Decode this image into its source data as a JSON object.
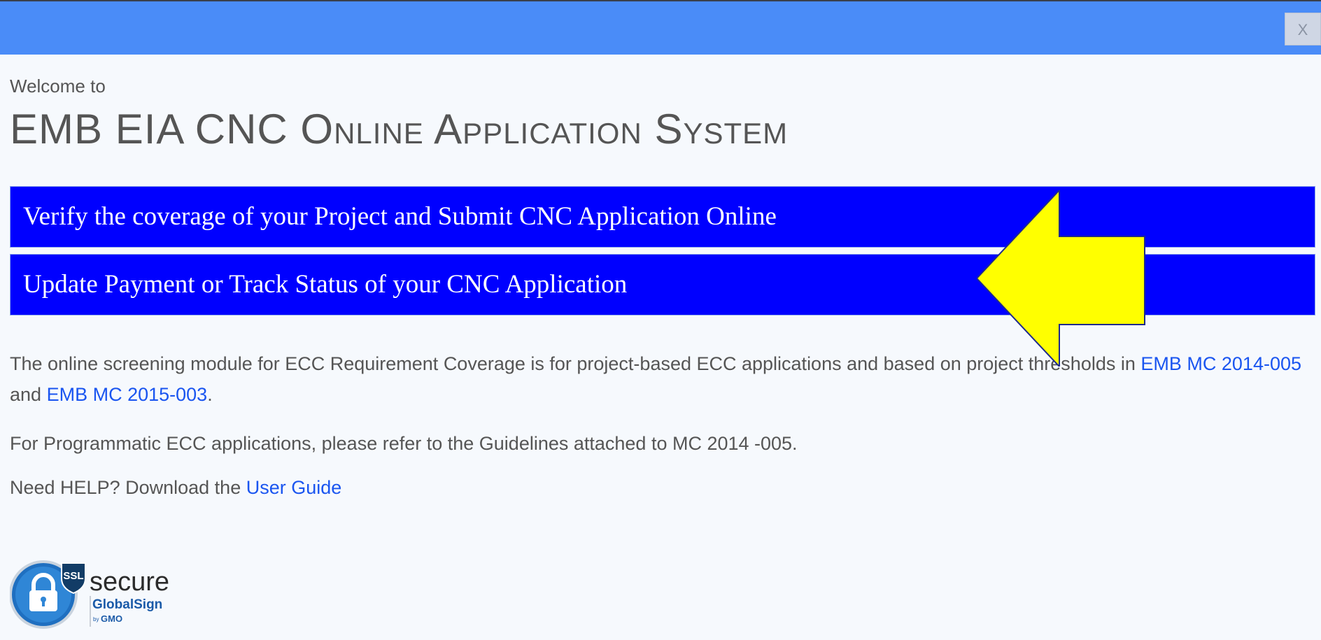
{
  "titlebar": {
    "close_label": "X"
  },
  "header": {
    "welcome": "Welcome to",
    "title": "EMB EIA CNC Online Application System"
  },
  "actions": {
    "verify_label": "Verify the coverage of your Project and Submit  CNC Application Online",
    "update_label": "Update Payment or Track Status of your CNC Application"
  },
  "info": {
    "screening_text": "The online screening module for ECC Requirement Coverage is for project-based ECC applications and based on project thresholds in",
    "mc_2014_link": "EMB MC 2014-005",
    "and_text": "and",
    "mc_2015_link": "EMB MC 2015-003",
    "period": ".",
    "programmatic_text": "For Programmatic ECC applications, please refer to the Guidelines attached to MC 2014 -005.",
    "help_text": "Need HELP? Download the",
    "user_guide_link": "User Guide"
  },
  "seal": {
    "ssl": "SSL",
    "secure": "secure",
    "brand": "GlobalSign",
    "by": "by",
    "gmo": "GMO"
  },
  "colors": {
    "titlebar": "#4a8cf8",
    "cta_background": "#0000ff",
    "link": "#1a55f0",
    "arrow_fill": "#ffff00",
    "arrow_stroke": "#1e2a8c"
  },
  "icons": {
    "arrow": "left-arrow-pointer-icon",
    "ssl_badge": "padlock-shield-icon"
  }
}
